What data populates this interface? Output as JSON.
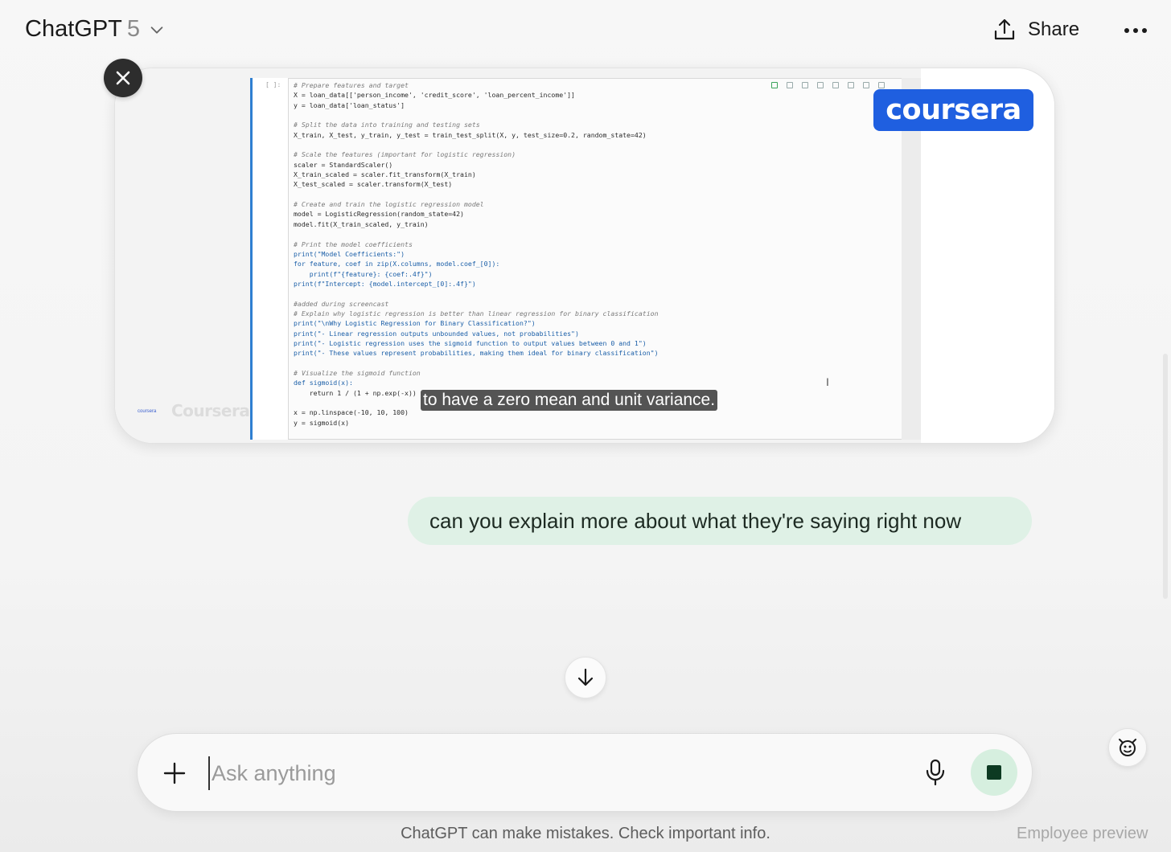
{
  "header": {
    "model_name": "ChatGPT",
    "model_version": "5",
    "share_label": "Share"
  },
  "video": {
    "logo_text": "coursera",
    "watermark_text": "Coursera",
    "watermark_small": "coursera",
    "caption": "to have a zero mean and unit variance.",
    "cell_prompt": "[ ]:",
    "code_lines": [
      {
        "t": "# Prepare features and target",
        "s": "c"
      },
      {
        "t": "X = loan_data[['person_income', 'credit_score', 'loan_percent_income']]",
        "s": ""
      },
      {
        "t": "y = loan_data['loan_status']",
        "s": ""
      },
      {
        "t": "",
        "s": ""
      },
      {
        "t": "# Split the data into training and testing sets",
        "s": "c"
      },
      {
        "t": "X_train, X_test, y_train, y_test = train_test_split(X, y, test_size=0.2, random_state=42)",
        "s": ""
      },
      {
        "t": "",
        "s": ""
      },
      {
        "t": "# Scale the features (important for logistic regression)",
        "s": "c"
      },
      {
        "t": "scaler = StandardScaler()",
        "s": ""
      },
      {
        "t": "X_train_scaled = scaler.fit_transform(X_train)",
        "s": ""
      },
      {
        "t": "X_test_scaled = scaler.transform(X_test)",
        "s": ""
      },
      {
        "t": "",
        "s": ""
      },
      {
        "t": "# Create and train the logistic regression model",
        "s": "c"
      },
      {
        "t": "model = LogisticRegression(random_state=42)",
        "s": ""
      },
      {
        "t": "model.fit(X_train_scaled, y_train)",
        "s": ""
      },
      {
        "t": "",
        "s": ""
      },
      {
        "t": "# Print the model coefficients",
        "s": "c"
      },
      {
        "t": "print(\"Model Coefficients:\")",
        "s": "k"
      },
      {
        "t": "for feature, coef in zip(X.columns, model.coef_[0]):",
        "s": "k"
      },
      {
        "t": "    print(f\"{feature}: {coef:.4f}\")",
        "s": "k"
      },
      {
        "t": "print(f\"Intercept: {model.intercept_[0]:.4f}\")",
        "s": "k"
      },
      {
        "t": "",
        "s": ""
      },
      {
        "t": "#added during screencast",
        "s": "c"
      },
      {
        "t": "# Explain why logistic regression is better than linear regression for binary classification",
        "s": "c"
      },
      {
        "t": "print(\"\\nWhy Logistic Regression for Binary Classification?\")",
        "s": "k"
      },
      {
        "t": "print(\"- Linear regression outputs unbounded values, not probabilities\")",
        "s": "k"
      },
      {
        "t": "print(\"- Logistic regression uses the sigmoid function to output values between 0 and 1\")",
        "s": "k"
      },
      {
        "t": "print(\"- These values represent probabilities, making them ideal for binary classification\")",
        "s": "k"
      },
      {
        "t": "",
        "s": ""
      },
      {
        "t": "# Visualize the sigmoid function",
        "s": "c"
      },
      {
        "t": "def sigmoid(x):",
        "s": "k"
      },
      {
        "t": "    return 1 / (1 + np.exp(-x))",
        "s": ""
      },
      {
        "t": "",
        "s": ""
      },
      {
        "t": "x = np.linspace(-10, 10, 100)",
        "s": ""
      },
      {
        "t": "y = sigmoid(x)",
        "s": ""
      }
    ]
  },
  "messages": [
    {
      "role": "user",
      "text": "can you explain more about what they're saying right now"
    }
  ],
  "composer": {
    "placeholder": "Ask anything"
  },
  "footer": {
    "disclaimer": "ChatGPT can make mistakes. Check important info.",
    "preview_label": "Employee preview"
  },
  "icons": {
    "model_dropdown": "chevron-down-icon",
    "share": "share-upload-icon",
    "more": "ellipsis-icon",
    "close": "close-icon",
    "scroll_down": "arrow-down-icon",
    "attach": "plus-icon",
    "mic": "microphone-icon",
    "stop": "stop-icon",
    "voice_mode": "voice-mode-icon"
  },
  "colors": {
    "user_bubble": "#dff1e6",
    "stop_button": "#d6efdf",
    "coursera_blue": "#1f5fe0",
    "caption_bg": "#3c3c3c"
  }
}
